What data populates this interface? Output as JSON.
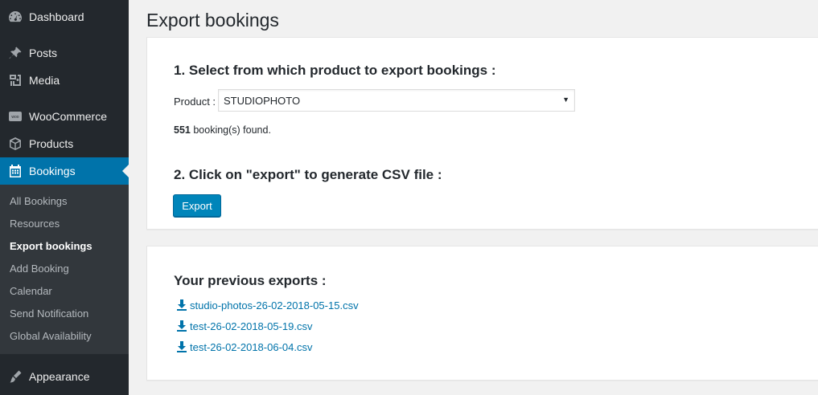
{
  "sidebar": {
    "items": [
      {
        "label": "Dashboard",
        "icon": "dashboard-icon"
      },
      {
        "label": "Posts",
        "icon": "pin-icon"
      },
      {
        "label": "Media",
        "icon": "media-icon"
      },
      {
        "label": "WooCommerce",
        "icon": "woo-icon"
      },
      {
        "label": "Products",
        "icon": "box-icon"
      },
      {
        "label": "Bookings",
        "icon": "calendar-icon"
      },
      {
        "label": "Appearance",
        "icon": "brush-icon"
      }
    ],
    "submenu": [
      {
        "label": "All Bookings"
      },
      {
        "label": "Resources"
      },
      {
        "label": "Export bookings"
      },
      {
        "label": "Add Booking"
      },
      {
        "label": "Calendar"
      },
      {
        "label": "Send Notification"
      },
      {
        "label": "Global Availability"
      }
    ],
    "active_item": "Bookings",
    "current_subitem": "Export bookings"
  },
  "page": {
    "title": "Export bookings"
  },
  "export_card": {
    "step1_heading": "1. Select from which product to export bookings :",
    "product_label": "Product :",
    "product_value": "STUDIOPHOTO",
    "found_count": "551",
    "found_suffix": " booking(s) found.",
    "step2_heading": "2. Click on \"export\" to generate CSV file :",
    "export_button": "Export"
  },
  "previous_card": {
    "heading": "Your previous exports :",
    "files": [
      "studio-photos-26-02-2018-05-15.csv",
      "test-26-02-2018-05-19.csv",
      "test-26-02-2018-06-04.csv"
    ]
  },
  "colors": {
    "sidebar_bg": "#23282d",
    "submenu_bg": "#32373c",
    "accent": "#0073aa",
    "button": "#0085ba"
  }
}
